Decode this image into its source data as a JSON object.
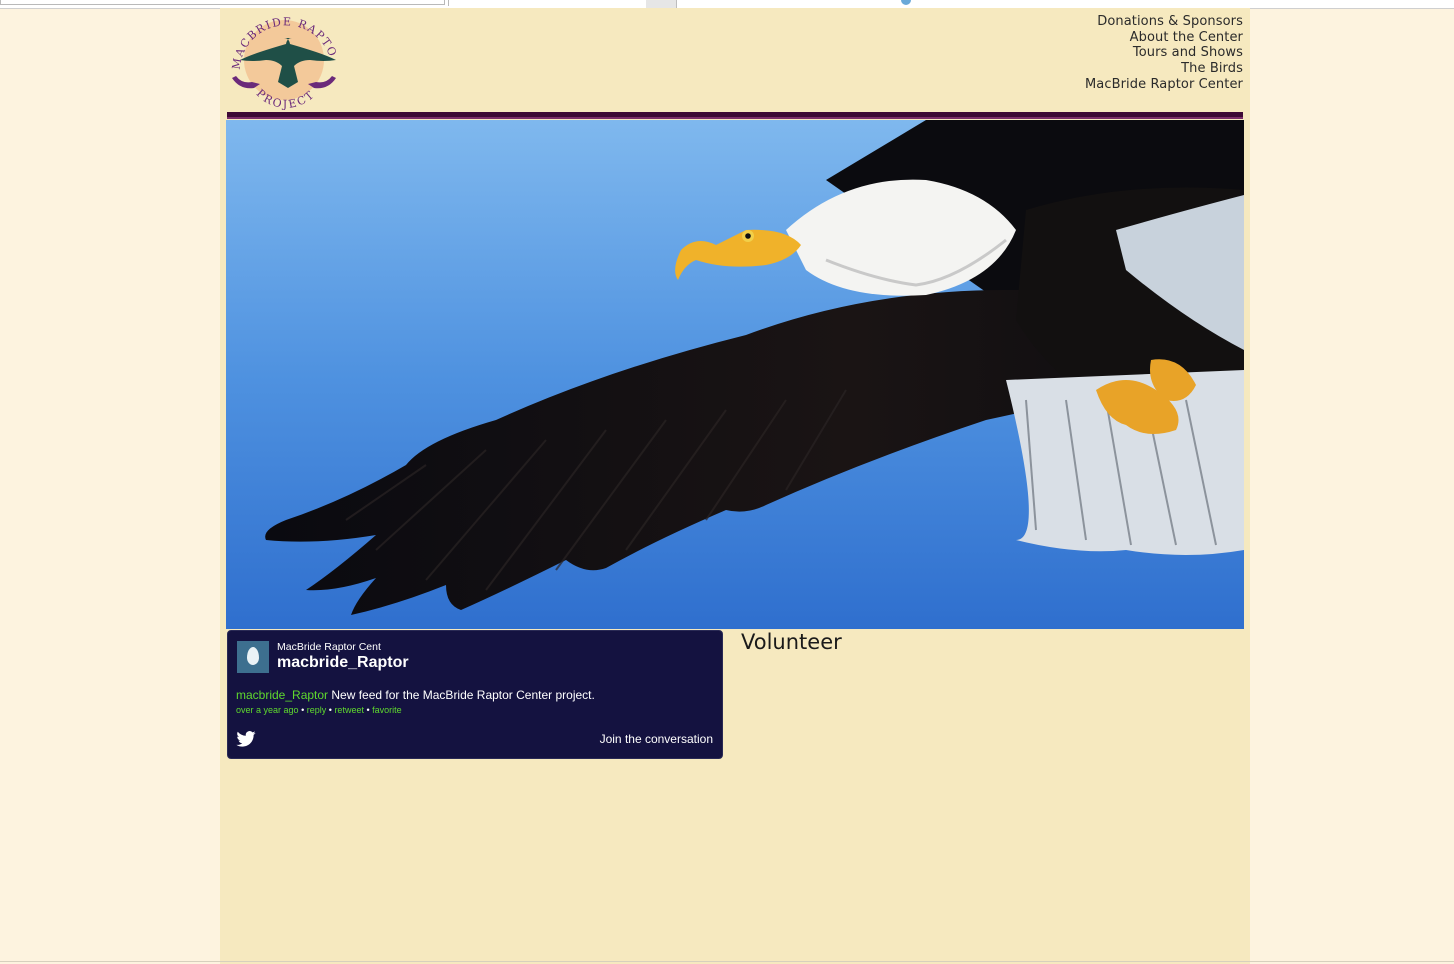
{
  "logo": {
    "text_top": "MACBRIDE RAPTOR",
    "text_bottom": "PROJECT"
  },
  "nav": {
    "items": [
      {
        "label": "Donations &  Sponsors"
      },
      {
        "label": "About the Center"
      },
      {
        "label": "Tours and Shows"
      },
      {
        "label": "The Birds"
      },
      {
        "label": "MacBride Raptor Center"
      }
    ]
  },
  "hero": {
    "subject": "bald eagle in flight"
  },
  "twitter": {
    "display_name": "MacBride Raptor Cent",
    "handle": "macbride_Raptor",
    "tweet_user": "macbride_Raptor",
    "tweet_text": " New feed for the MacBride Raptor Center project.",
    "time": "over a year ago",
    "reply": "reply",
    "retweet": "retweet",
    "favorite": "favorite",
    "join": "Join the conversation"
  },
  "section": {
    "title": "Volunteer"
  },
  "colors": {
    "page_bg": "#fdf3df",
    "content_bg": "#f6e9bf",
    "divider": "#3d0a35",
    "widget_bg": "#141240",
    "link_green": "#5fd92e"
  }
}
